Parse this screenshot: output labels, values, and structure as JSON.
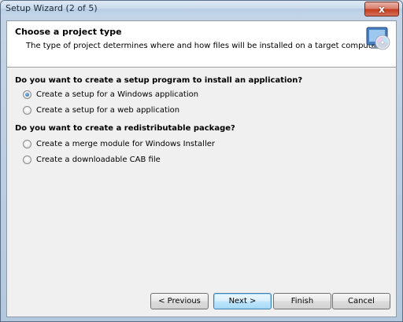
{
  "window": {
    "title": "Setup Wizard (2 of 5)",
    "close_glyph": "x"
  },
  "header": {
    "title": "Choose a project type",
    "description": "The type of project determines where and how files will be installed on a target computer.",
    "icon": "setup-disc-icon"
  },
  "sections": [
    {
      "heading": "Do you want to create a setup program to install an application?",
      "options": [
        {
          "label": "Create a setup for a Windows application",
          "checked": true
        },
        {
          "label": "Create a setup for a web application",
          "checked": false
        }
      ]
    },
    {
      "heading": "Do you want to create a redistributable package?",
      "options": [
        {
          "label": "Create a merge module for Windows Installer",
          "checked": false
        },
        {
          "label": "Create a downloadable CAB file",
          "checked": false
        }
      ]
    }
  ],
  "buttons": {
    "previous": "< Previous",
    "next": "Next >",
    "finish": "Finish",
    "cancel": "Cancel"
  },
  "colors": {
    "accent": "#3c7fb1",
    "close_button": "#c23c1f"
  }
}
